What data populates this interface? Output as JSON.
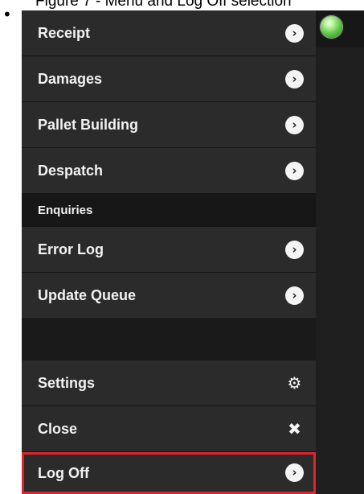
{
  "caption": {
    "bullet": "•",
    "text": "Figure 7 - Menu and Log Off selection"
  },
  "status": {
    "indicator_color": "#5fc84a"
  },
  "menu": {
    "items": [
      {
        "label": "Receipt",
        "icon": "chevron-right-icon",
        "glyph": "›"
      },
      {
        "label": "Damages",
        "icon": "chevron-right-icon",
        "glyph": "›"
      },
      {
        "label": "Pallet Building",
        "icon": "chevron-right-icon",
        "glyph": "›"
      },
      {
        "label": "Despatch",
        "icon": "chevron-right-icon",
        "glyph": "›"
      }
    ],
    "section_header": "Enquiries",
    "enquiry_items": [
      {
        "label": "Error Log",
        "icon": "chevron-right-icon",
        "glyph": "›"
      },
      {
        "label": "Update Queue",
        "icon": "chevron-right-icon",
        "glyph": "›"
      }
    ],
    "footer_items": [
      {
        "label": "Settings",
        "icon": "gear-icon",
        "glyph": "⚙"
      },
      {
        "label": "Close",
        "icon": "close-icon",
        "glyph": "✖"
      },
      {
        "label": "Log Off",
        "icon": "chevron-right-icon",
        "glyph": "›",
        "highlighted": true
      }
    ]
  },
  "colors": {
    "highlight": "#e0242a",
    "menu_background": "#2b2b2b",
    "header_background": "#171717"
  }
}
